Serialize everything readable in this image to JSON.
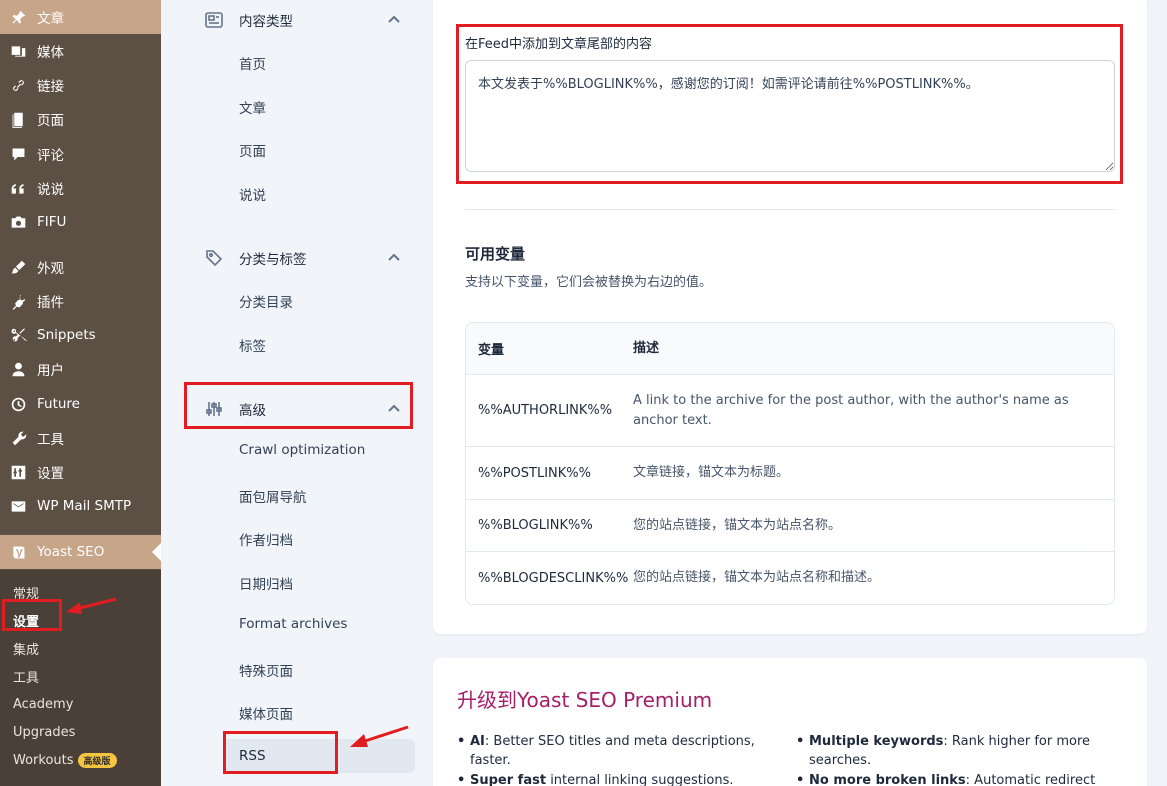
{
  "wp_menu": [
    {
      "label": "文章",
      "icon": "pin-icon"
    },
    {
      "label": "媒体",
      "icon": "media-icon"
    },
    {
      "label": "链接",
      "icon": "link-icon"
    },
    {
      "label": "页面",
      "icon": "page-icon"
    },
    {
      "label": "评论",
      "icon": "comment-icon"
    },
    {
      "label": "说说",
      "icon": "quote-icon"
    },
    {
      "label": "FIFU",
      "icon": "camera-icon"
    },
    {
      "label": "外观",
      "icon": "brush-icon"
    },
    {
      "label": "插件",
      "icon": "plugin-icon"
    },
    {
      "label": "Snippets",
      "icon": "scissors-icon"
    },
    {
      "label": "用户",
      "icon": "user-icon"
    },
    {
      "label": "Future",
      "icon": "clock-icon"
    },
    {
      "label": "工具",
      "icon": "wrench-icon"
    },
    {
      "label": "设置",
      "icon": "settings-icon"
    },
    {
      "label": "WP Mail SMTP",
      "icon": "mail-icon"
    },
    {
      "label": "Yoast SEO",
      "icon": "yoast-icon"
    }
  ],
  "yoast_submenu": [
    {
      "label": "常规"
    },
    {
      "label": "设置"
    },
    {
      "label": "集成"
    },
    {
      "label": "工具"
    },
    {
      "label": "Academy"
    },
    {
      "label": "Upgrades"
    },
    {
      "label": "Workouts",
      "badge": "高级版"
    }
  ],
  "nav": {
    "content_types": {
      "title": "内容类型",
      "links": [
        "首页",
        "文章",
        "页面",
        "说说"
      ]
    },
    "taxonomies": {
      "title": "分类与标签",
      "links": [
        "分类目录",
        "标签"
      ]
    },
    "advanced": {
      "title": "高级",
      "links": [
        "Crawl optimization",
        "面包屑导航",
        "作者归档",
        "日期归档",
        "Format archives",
        "特殊页面",
        "媒体页面",
        "RSS"
      ]
    }
  },
  "main": {
    "feed_after_label": "在Feed中添加到文章尾部的内容",
    "feed_after_value": "本文发表于%%BLOGLINK%%，感谢您的订阅！如需评论请前往%%POSTLINK%%。",
    "vars_title": "可用变量",
    "vars_desc": "支持以下变量，它们会被替换为右边的值。",
    "table_head": {
      "variable": "变量",
      "description": "描述"
    },
    "table_rows": [
      {
        "variable": "%%AUTHORLINK%%",
        "description": "A link to the archive for the post author, with the author's name as anchor text."
      },
      {
        "variable": "%%POSTLINK%%",
        "description": "文章链接，锚文本为标题。"
      },
      {
        "variable": "%%BLOGLINK%%",
        "description": "您的站点链接，锚文本为站点名称。"
      },
      {
        "variable": "%%BLOGDESCLINK%%",
        "description": "您的站点链接，锚文本为站点名称和描述。"
      }
    ]
  },
  "premium": {
    "title": "升级到Yoast SEO Premium",
    "features": [
      {
        "bold": "AI",
        "text": ": Better SEO titles and meta descriptions, faster."
      },
      {
        "bold": "Multiple keywords",
        "text": ": Rank higher for more searches."
      },
      {
        "bold": "Super fast",
        "text": " internal linking suggestions."
      },
      {
        "bold": "No more broken links",
        "text": ": Automatic redirect"
      }
    ]
  },
  "colors": {
    "wp_sidebar": "#5c4f43",
    "wp_active": "#c7a589",
    "premium_title": "#a61e69",
    "annotation_red": "#e11d22"
  }
}
